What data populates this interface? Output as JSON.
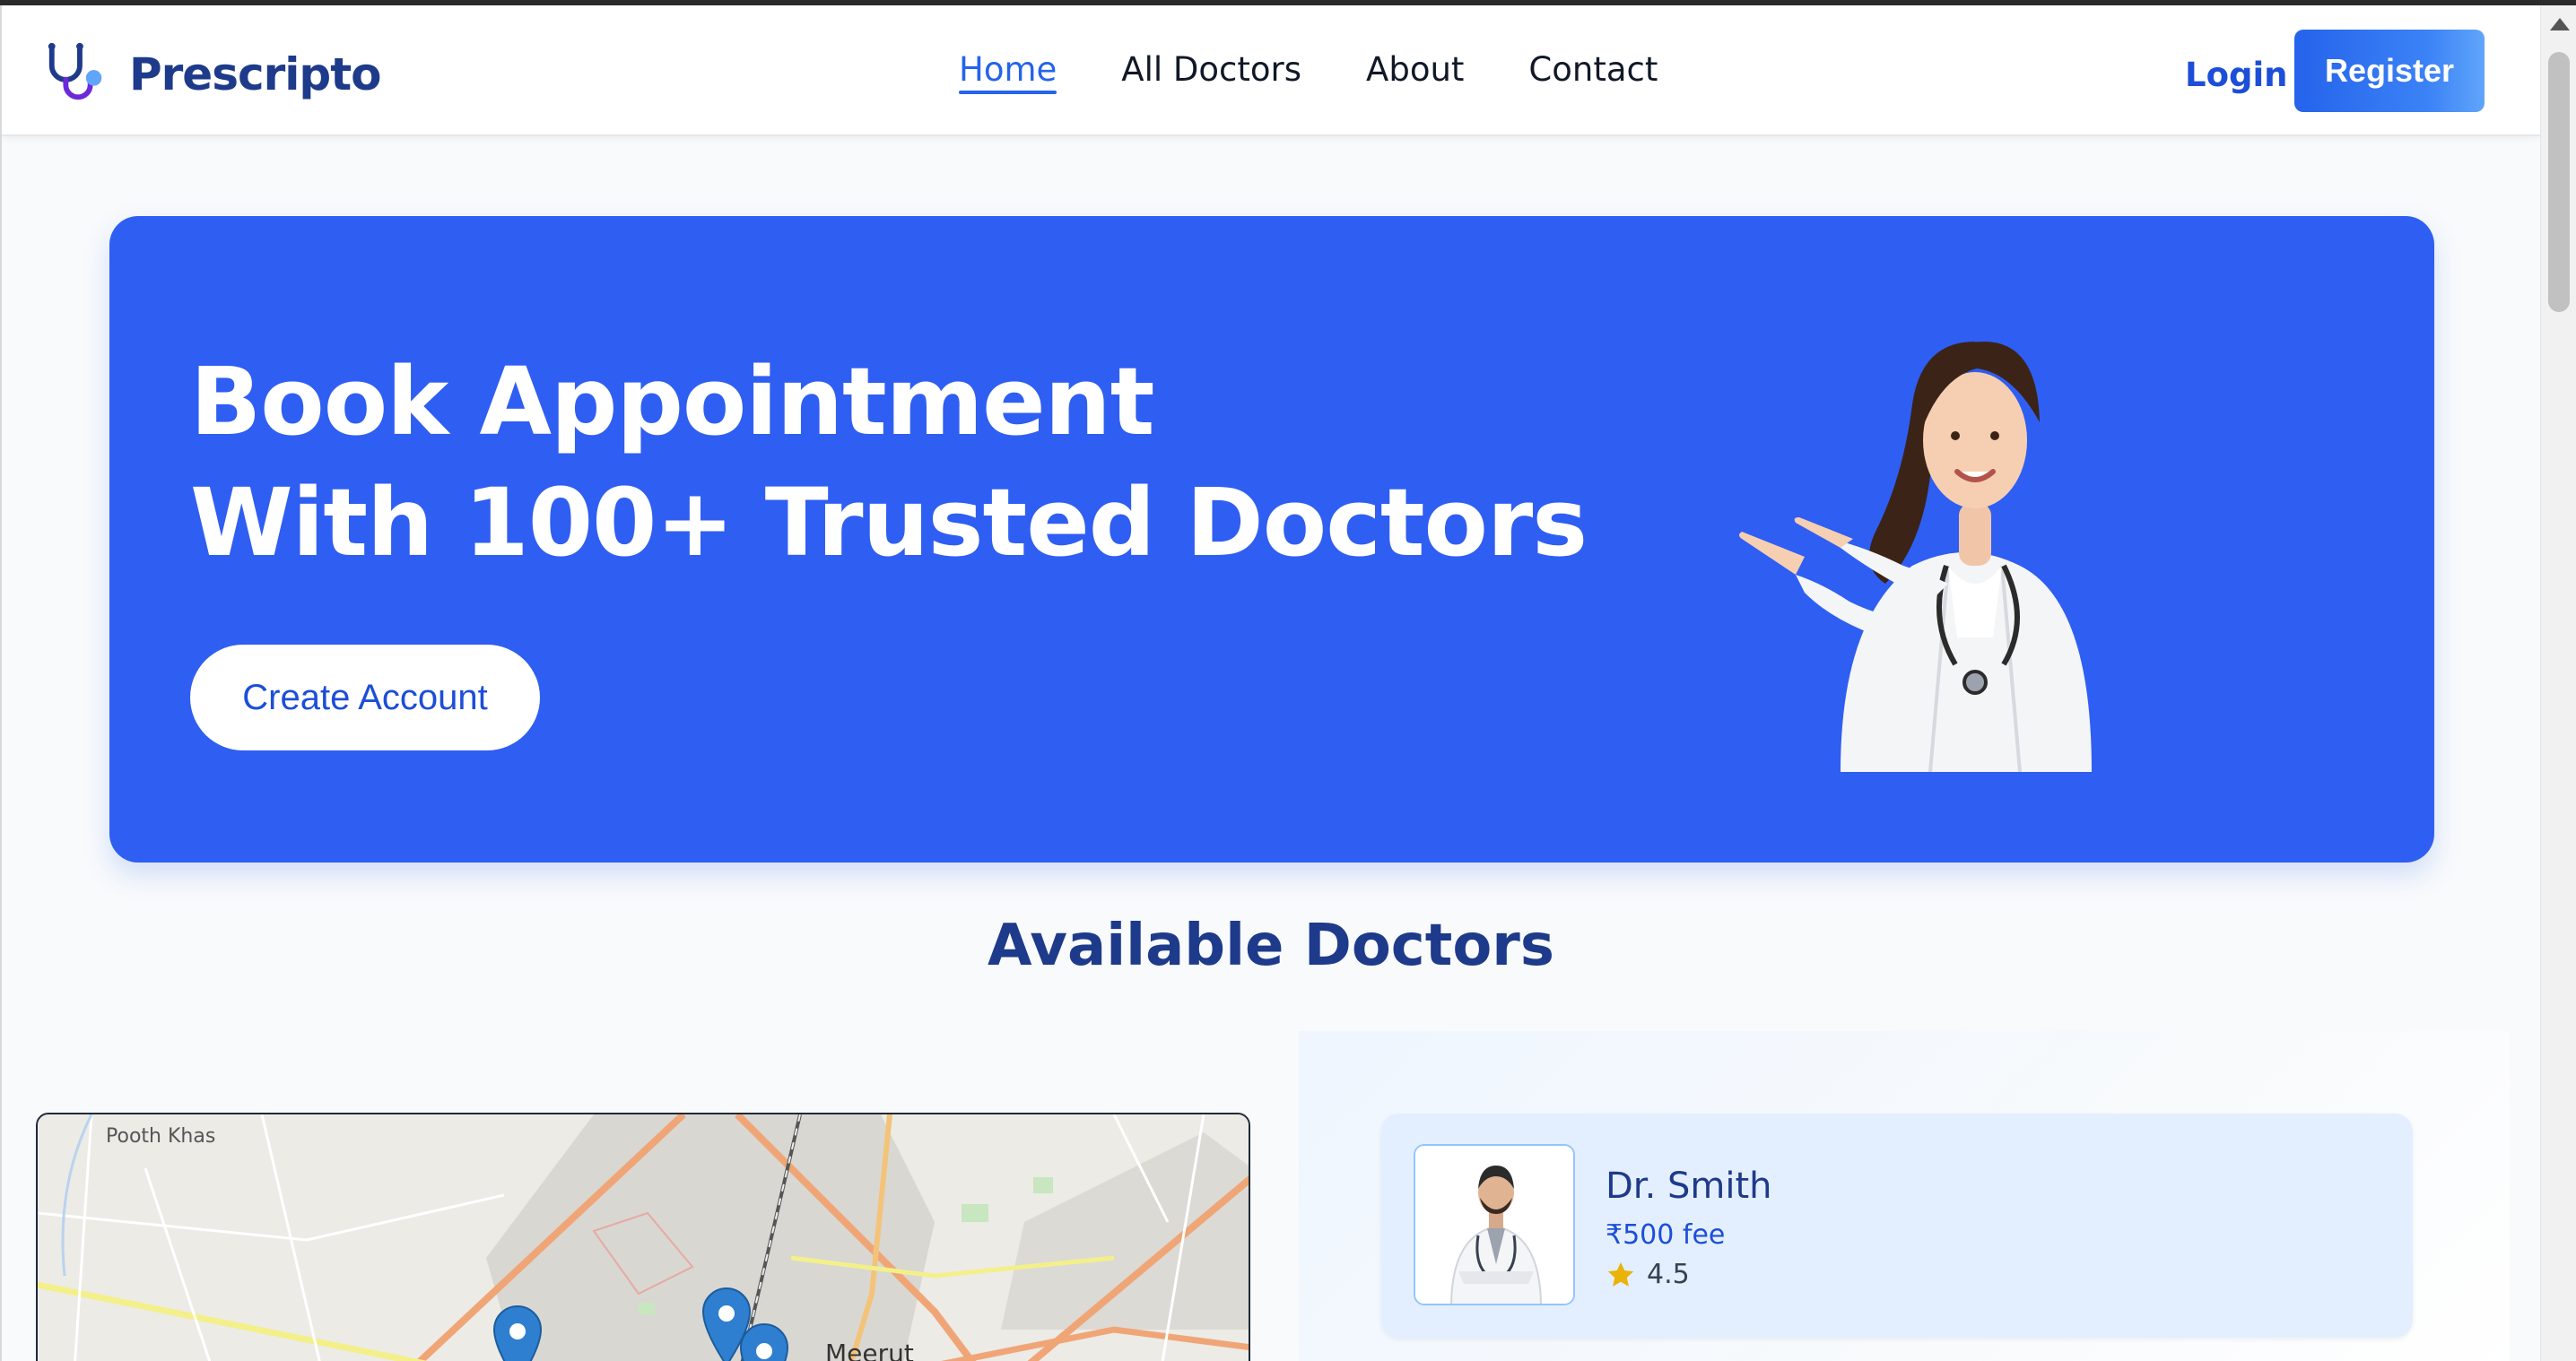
{
  "brand": {
    "name": "Prescripto"
  },
  "nav": [
    {
      "label": "Home",
      "active": true
    },
    {
      "label": "All Doctors",
      "active": false
    },
    {
      "label": "About",
      "active": false
    },
    {
      "label": "Contact",
      "active": false
    }
  ],
  "auth": {
    "login_label": "Login",
    "register_label": "Register"
  },
  "hero": {
    "title_line1": "Book Appointment",
    "title_line2": "With 100+ Trusted Doctors",
    "cta_label": "Create Account"
  },
  "section": {
    "title": "Available Doctors"
  },
  "map": {
    "labels": {
      "pooth_khas": "Pooth Khas",
      "meerut": "Meerut"
    }
  },
  "doctors": [
    {
      "name": "Dr. Smith",
      "fee": "₹500 fee",
      "rating": "4.5"
    }
  ],
  "colors": {
    "primary": "#2f5ef2",
    "brand_dark": "#1e3a8a",
    "star": "#eab308"
  },
  "icons": {
    "logo": "stethoscope-icon",
    "rating": "star-icon",
    "map_marker": "map-pin-icon"
  }
}
